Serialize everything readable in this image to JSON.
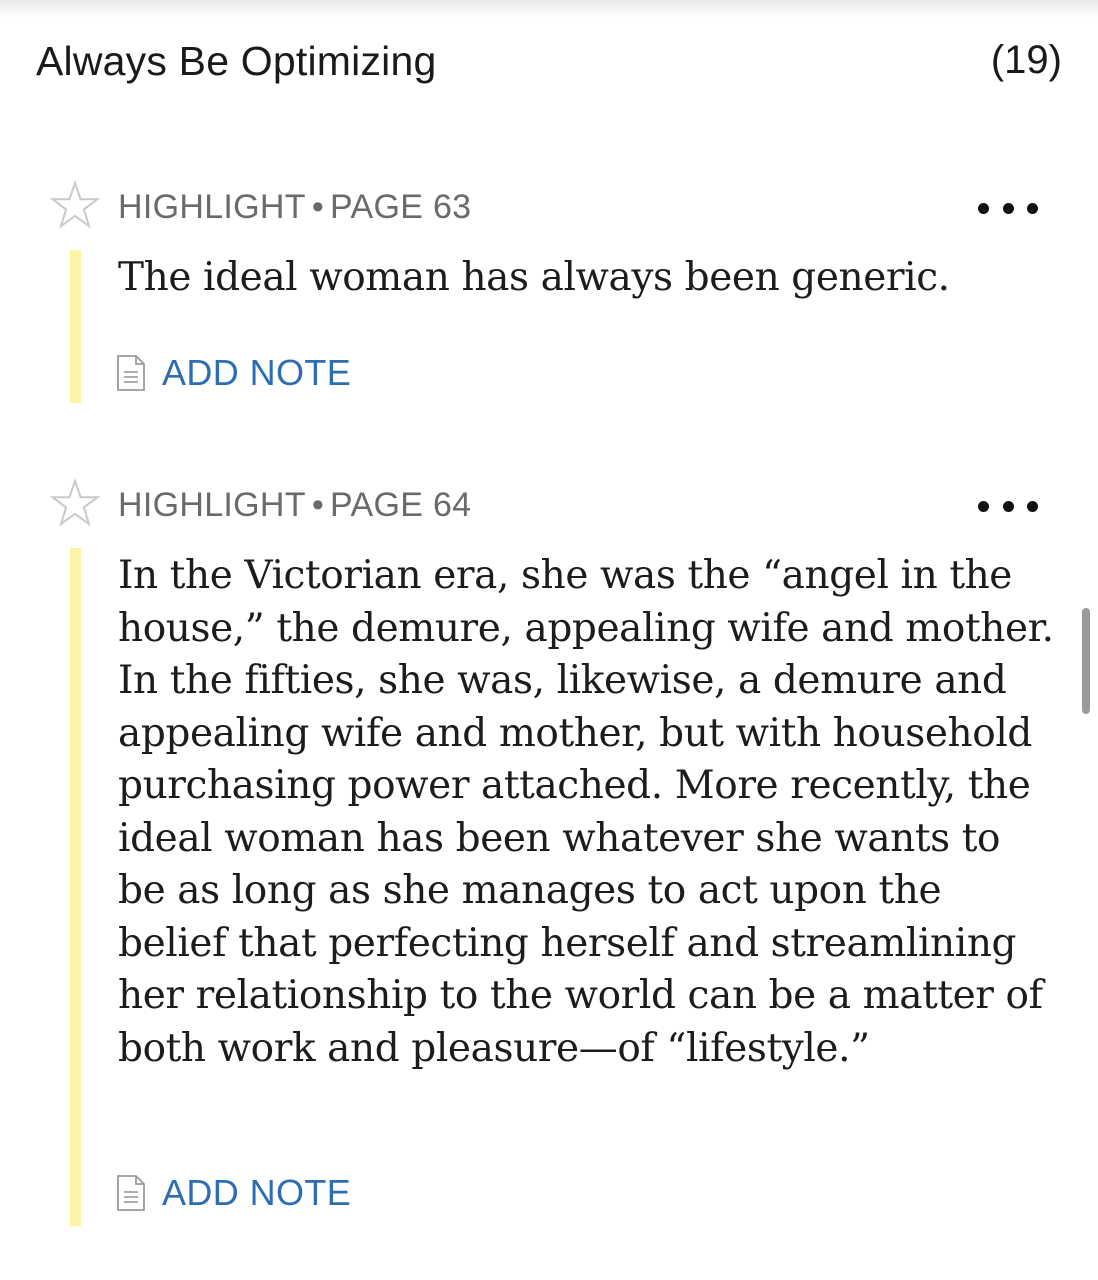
{
  "chapter": {
    "title": "Always Be Optimizing",
    "count": "(19)"
  },
  "highlights": [
    {
      "type": "HIGHLIGHT",
      "separator": "•",
      "page": "PAGE 63",
      "text": "The ideal woman has always been generic.",
      "add_note_label": "ADD NOTE",
      "highlight_color": "#fbf3a6"
    },
    {
      "type": "HIGHLIGHT",
      "separator": "•",
      "page": "PAGE 64",
      "text": "In the Victorian era, she was the “angel in the house,” the demure, appealing wife and mother. In the fifties, she was, likewise, a demure and appealing wife and mother, but with household purchasing power attached. More recently, the ideal woman has been whatever she wants to be as long as she manages to act upon the belief that perfecting herself and streamlining her relationship to the world can be a matter of both work and pleasure—of “lifestyle.”",
      "add_note_label": "ADD NOTE",
      "highlight_color": "#fbf3a6"
    }
  ],
  "colors": {
    "link": "#2f6db3",
    "meta": "#6a6a6a",
    "text": "#1c1c1c"
  },
  "icons": {
    "favorite": "star-outline-icon",
    "menu": "more-dots-icon",
    "note": "note-document-icon"
  }
}
